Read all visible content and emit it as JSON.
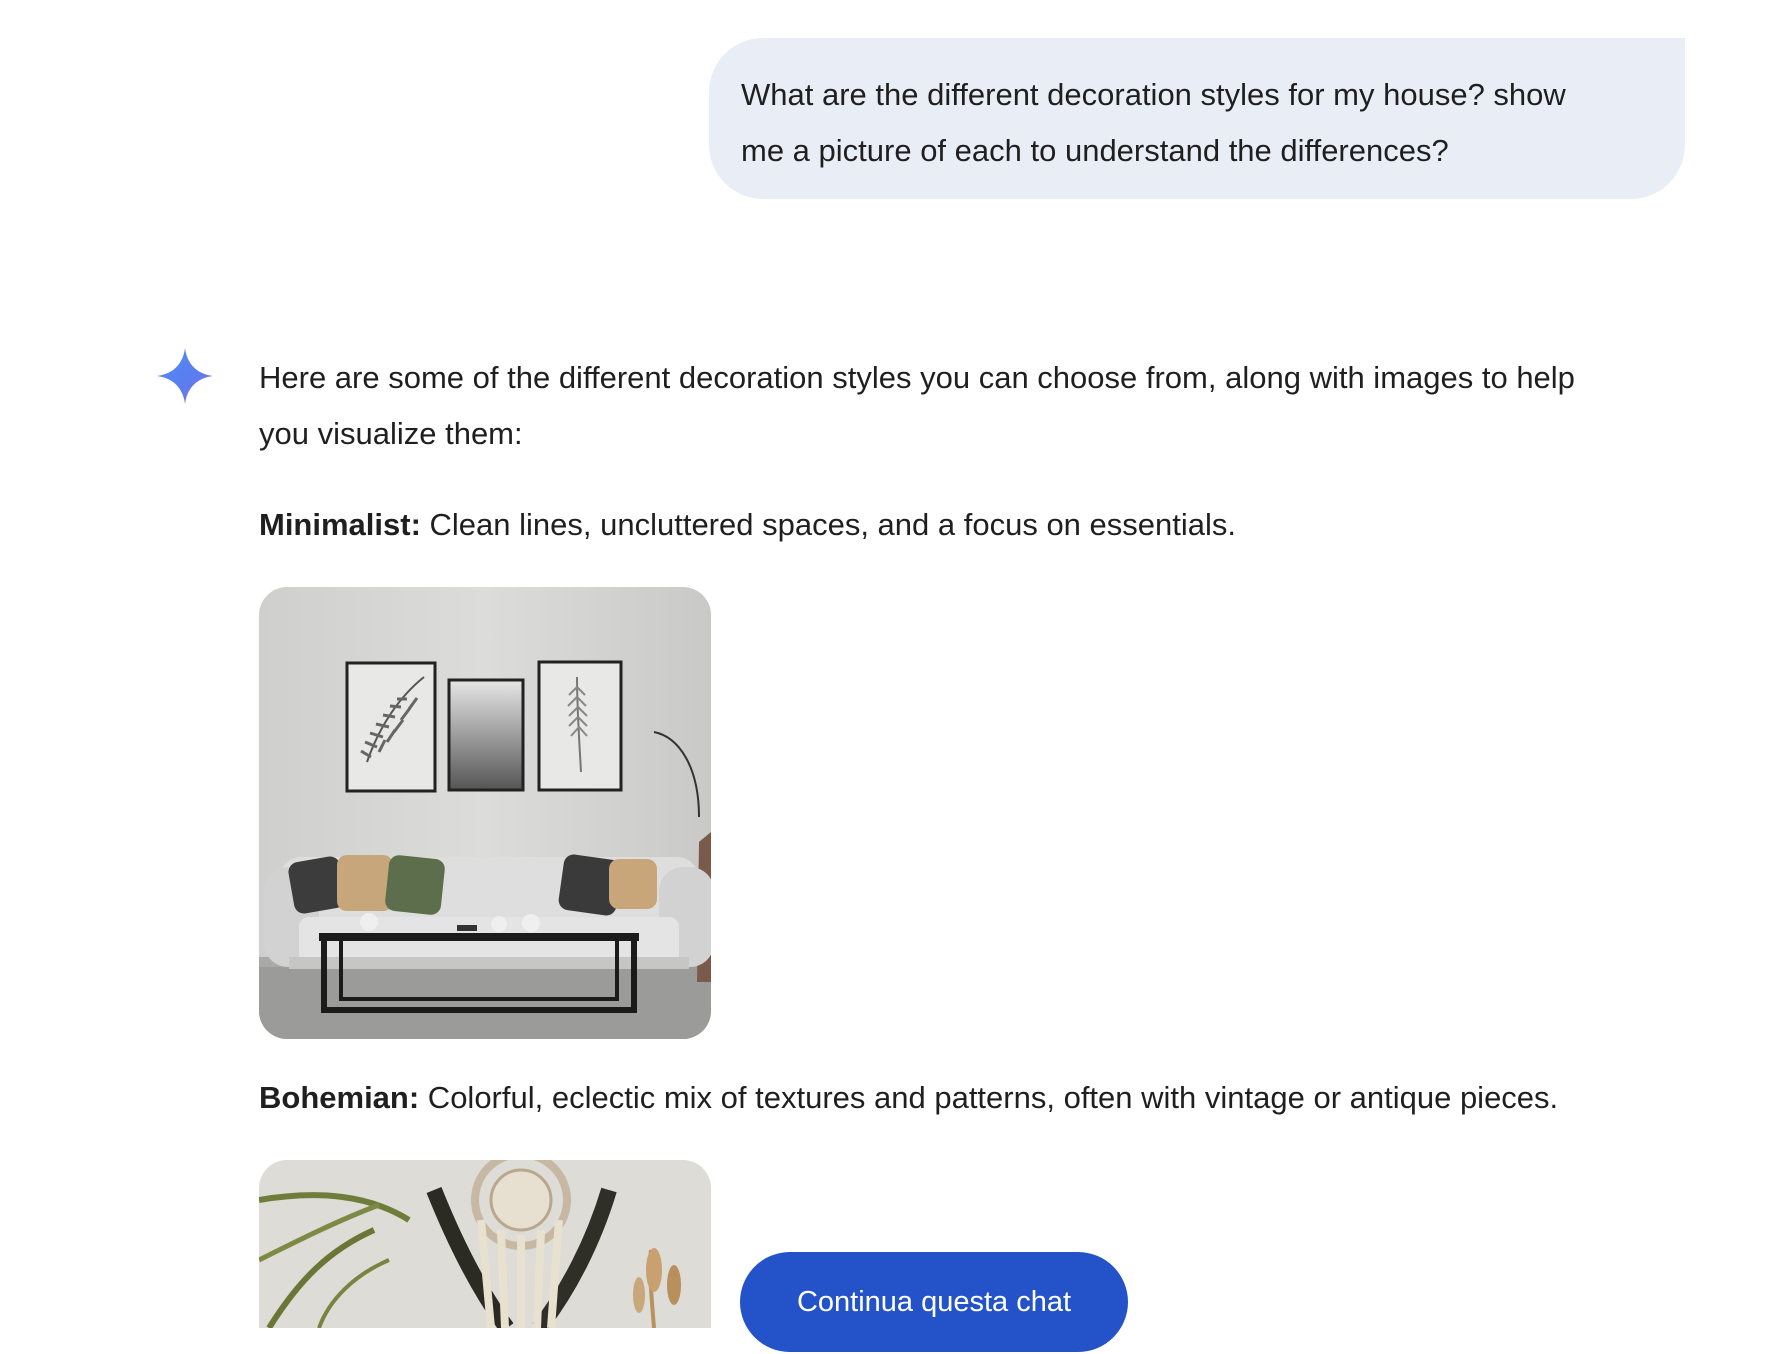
{
  "user_message": {
    "line1": "What are the different decoration styles for my house? show",
    "line2": "me a picture of each to understand the differences?"
  },
  "assistant": {
    "icon": "gemini-sparkle-icon",
    "intro_line1": "Here are some of the different decoration styles you can choose from, along with images to help",
    "intro_line2": "you visualize them:",
    "styles": [
      {
        "name": "Minimalist:",
        "description": " Clean lines, uncluttered spaces, and a focus on essentials.",
        "image": "minimalist-living-room-image"
      },
      {
        "name": "Bohemian:",
        "description": " Colorful, eclectic mix of textures and patterns, often with vintage or antique pieces.",
        "image": "bohemian-dreamcatcher-image"
      }
    ]
  },
  "continue_button": {
    "label": "Continua questa chat"
  },
  "colors": {
    "user_bubble": "#e9eef6",
    "button": "#2453c9",
    "text": "#1f1f1f"
  }
}
